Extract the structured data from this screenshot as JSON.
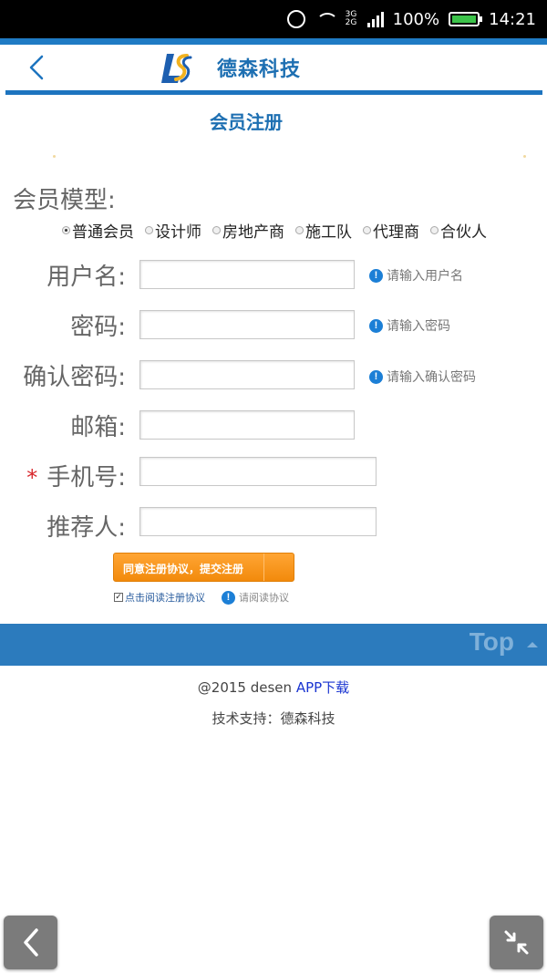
{
  "status_bar": {
    "network": "3G\n2G",
    "battery": "100%",
    "time": "14:21",
    "icons": [
      "alarm-icon",
      "wifi-icon",
      "signal-icon",
      "battery-icon"
    ]
  },
  "header": {
    "brand": "德森科技",
    "page_title": "会员注册",
    "colors": {
      "primary": "#1d74bf",
      "brand_text": "#1d6fb2",
      "logo_accent": "#f2b21f"
    }
  },
  "form": {
    "model_label": "会员模型:",
    "member_types": [
      "普通会员",
      "设计师",
      "房地产商",
      "施工队",
      "代理商",
      "合伙人"
    ],
    "selected_type": "普通会员",
    "fields": {
      "username": {
        "label": "用户名:",
        "value": "",
        "hint": "请输入用户名"
      },
      "password": {
        "label": "密码:",
        "value": "",
        "hint": "请输入密码"
      },
      "confirm_password": {
        "label": "确认密码:",
        "value": "",
        "hint": "请输入确认密码"
      },
      "email": {
        "label": "邮箱:",
        "value": ""
      },
      "phone": {
        "label": "手机号:",
        "required_mark": "*",
        "value": ""
      },
      "referrer": {
        "label": "推荐人:",
        "value": ""
      }
    },
    "submit_label": "同意注册协议，提交注册",
    "agree_checked": true,
    "agree_label": "点击阅读注册协议",
    "agree_hint": "请阅读协议"
  },
  "footer": {
    "top_label": "Top",
    "copyright": "@2015 desen",
    "app_link": "APP下载",
    "support": "技术支持：德森科技"
  },
  "floating": {
    "left_icon": "back-chevron-icon",
    "right_icon": "collapse-arrows-icon"
  }
}
